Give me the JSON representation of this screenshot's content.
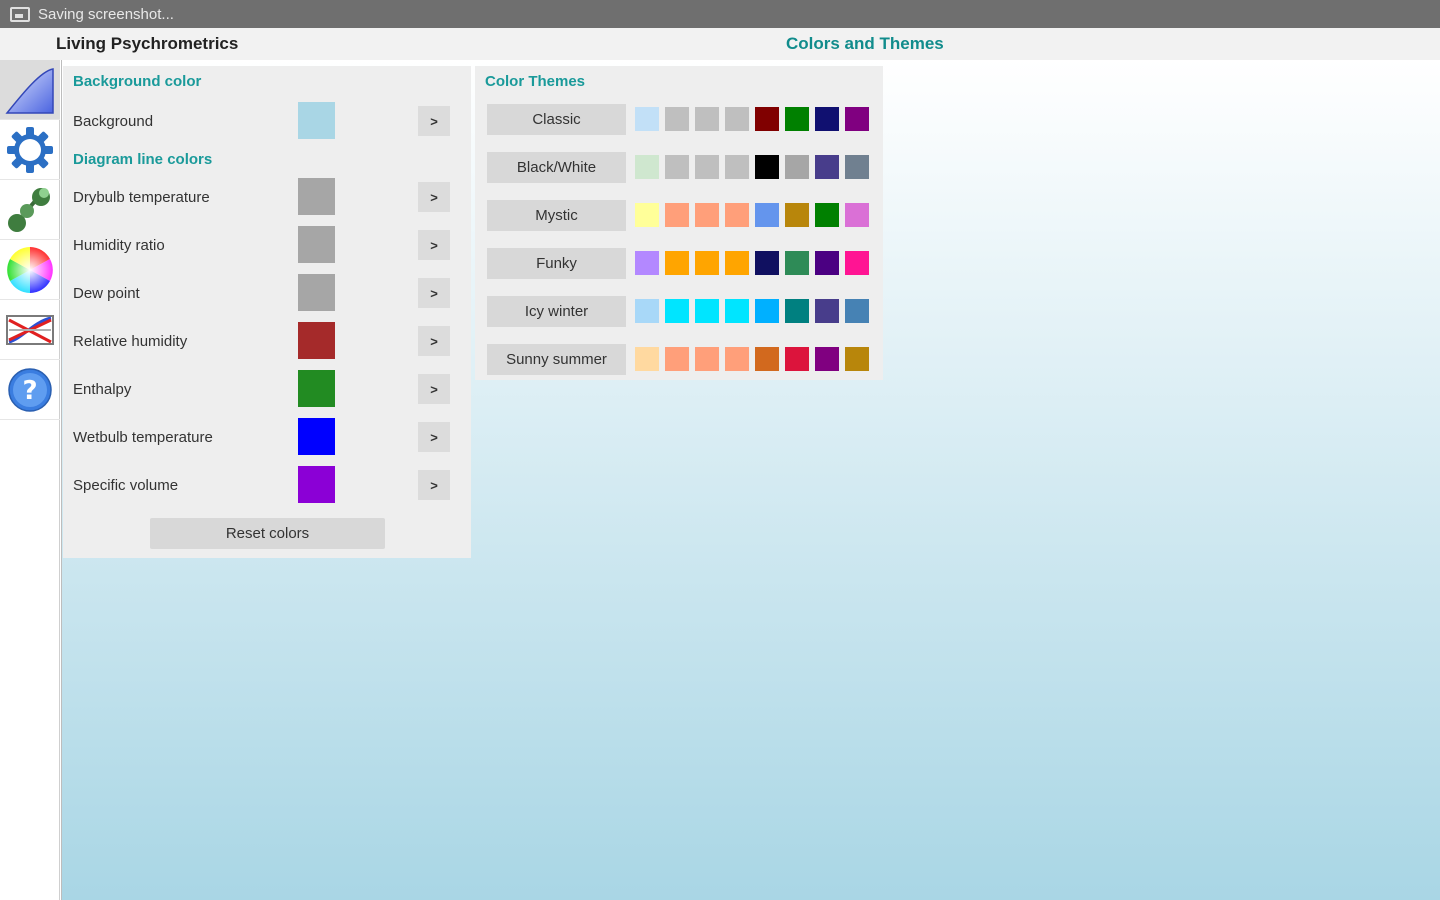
{
  "status_bar": {
    "text": "Saving screenshot..."
  },
  "header": {
    "app_title": "Living Psychrometrics",
    "section_title": "Colors and Themes"
  },
  "sidebar": {
    "items": [
      {
        "name": "chart-icon",
        "active": true
      },
      {
        "name": "gear-icon",
        "active": false
      },
      {
        "name": "process-icon",
        "active": false
      },
      {
        "name": "color-wheel-icon",
        "active": false
      },
      {
        "name": "compare-icon",
        "active": false
      },
      {
        "name": "help-icon",
        "active": false
      }
    ]
  },
  "colors_panel": {
    "background_heading": "Background color",
    "background": {
      "label": "Background",
      "color": "#a9d6e5",
      "button": ">"
    },
    "lines_heading": "Diagram line colors",
    "lines": [
      {
        "label": "Drybulb temperature",
        "color": "#a6a6a6",
        "button": ">"
      },
      {
        "label": "Humidity ratio",
        "color": "#a6a6a6",
        "button": ">"
      },
      {
        "label": "Dew point",
        "color": "#a6a6a6",
        "button": ">"
      },
      {
        "label": "Relative humidity",
        "color": "#a52a2a",
        "button": ">"
      },
      {
        "label": "Enthalpy",
        "color": "#228b22",
        "button": ">"
      },
      {
        "label": "Wetbulb temperature",
        "color": "#0000ff",
        "button": ">"
      },
      {
        "label": "Specific volume",
        "color": "#8b00d6",
        "button": ">"
      }
    ],
    "reset_label": "Reset colors"
  },
  "themes_panel": {
    "heading": "Color Themes",
    "themes": [
      {
        "label": "Classic",
        "colors": [
          "#c2e0f7",
          "#bfbfbf",
          "#bfbfbf",
          "#bfbfbf",
          "#800000",
          "#008000",
          "#101070",
          "#800080"
        ]
      },
      {
        "label": "Black/White",
        "colors": [
          "#cfe7cf",
          "#bfbfbf",
          "#bfbfbf",
          "#bfbfbf",
          "#000000",
          "#a6a6a6",
          "#483d8b",
          "#708090"
        ]
      },
      {
        "label": "Mystic",
        "colors": [
          "#ffff99",
          "#ff9f7a",
          "#ff9f7a",
          "#ff9f7a",
          "#6495ed",
          "#b8860b",
          "#008000",
          "#da70d6"
        ]
      },
      {
        "label": "Funky",
        "colors": [
          "#b388ff",
          "#ffa500",
          "#ffa500",
          "#ffa500",
          "#101060",
          "#2e8b57",
          "#4b0082",
          "#ff1493"
        ]
      },
      {
        "label": "Icy winter",
        "colors": [
          "#a8d8f8",
          "#00e5ff",
          "#00e5ff",
          "#00e5ff",
          "#00b0ff",
          "#008080",
          "#483d8b",
          "#4682b4"
        ]
      },
      {
        "label": "Sunny summer",
        "colors": [
          "#ffd9a0",
          "#ff9f7a",
          "#ff9f7a",
          "#ff9f7a",
          "#d2691e",
          "#dc143c",
          "#800080",
          "#b8860b"
        ]
      }
    ]
  }
}
